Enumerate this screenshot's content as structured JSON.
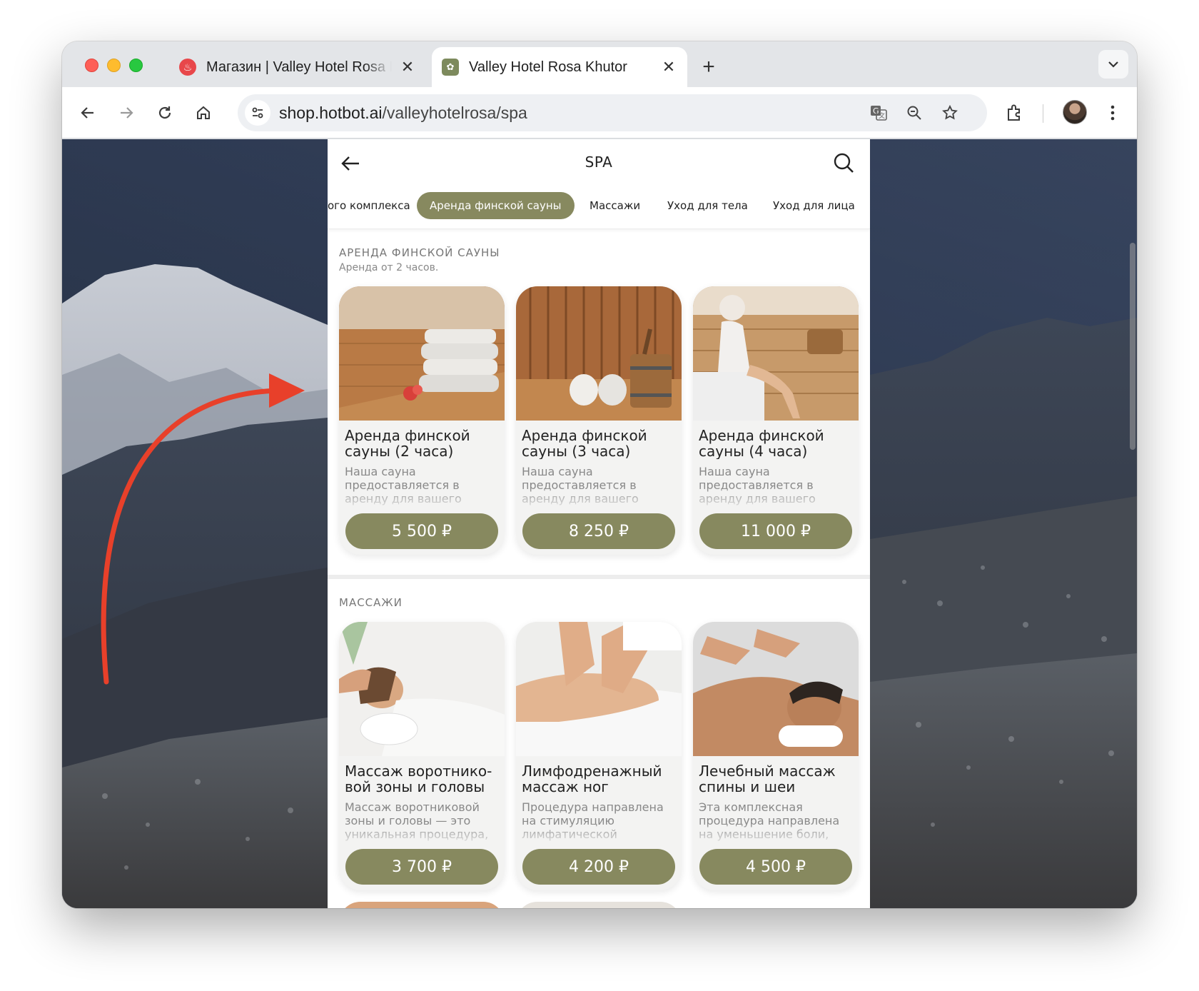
{
  "browser": {
    "tabs": [
      {
        "title": "Магазин | Valley Hotel Rosa Khutor",
        "active": false
      },
      {
        "title": "Valley Hotel Rosa Khutor",
        "active": true
      }
    ],
    "url_host": "shop.hotbot.ai",
    "url_path": "/valleyhotelrosa/spa",
    "icons": [
      "back-icon",
      "forward-icon",
      "reload-icon",
      "home-icon",
      "site-info-icon",
      "translate-icon",
      "zoom-icon",
      "bookmark-star-icon",
      "extensions-icon",
      "kebab-menu-icon"
    ]
  },
  "shop": {
    "title": "SPA",
    "categories": [
      {
        "label": "ого комплекса",
        "active": false
      },
      {
        "label": "Аренда финской сауны",
        "active": true
      },
      {
        "label": "Массажи",
        "active": false
      },
      {
        "label": "Уход для тела",
        "active": false
      },
      {
        "label": "Уход для лица",
        "active": false
      }
    ],
    "sections": [
      {
        "title": "АРЕНДА ФИНСКОЙ САУНЫ",
        "subtitle": "Аренда от 2 часов.",
        "items": [
          {
            "name": "Аренда финской сауны (2 часа)",
            "desc": "Наша сауна предоставляется в аренду для вашего",
            "price": "5 500 ₽"
          },
          {
            "name": "Аренда финской сауны (3 часа)",
            "desc": "Наша сауна предоставляется в аренду для вашего",
            "price": "8 250 ₽"
          },
          {
            "name": "Аренда финской сауны (4 часа)",
            "desc": "Наша сауна предоставляется в аренду для вашего",
            "price": "11 000 ₽"
          }
        ]
      },
      {
        "title": "МАССАЖИ",
        "subtitle": "",
        "items": [
          {
            "name": "Массаж воротнико-вой зоны и головы",
            "desc": "Массаж воротниковой зоны и головы — это уникальная процедура,",
            "price": "3 700 ₽"
          },
          {
            "name": "Лимфодренажный массаж ног",
            "desc": "Процедура направлена на стимуляцию лимфатической",
            "price": "4 200 ₽"
          },
          {
            "name": "Лечебный массаж спины и шеи",
            "desc": "Эта комплексная процедура направлена на уменьшение боли,",
            "price": "4 500 ₽"
          }
        ]
      }
    ]
  },
  "colors": {
    "accent": "#87895f",
    "annotation_arrow": "#e8402a"
  }
}
